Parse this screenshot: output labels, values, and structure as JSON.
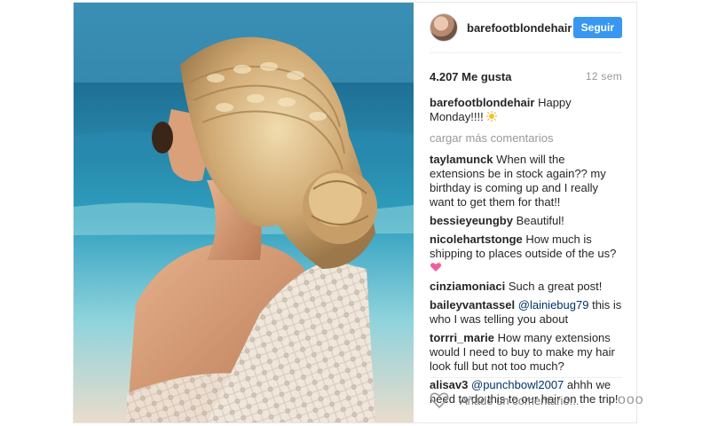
{
  "header": {
    "username": "barefootblondehair",
    "follow_label": "Seguir"
  },
  "stats": {
    "likes": "4.207 Me gusta",
    "time_ago": "12 sem"
  },
  "caption": {
    "user": "barefootblondehair",
    "text": "Happy Monday!!!!"
  },
  "load_more": "cargar más comentarios",
  "comments": [
    {
      "user": "taylamunck",
      "mention": "",
      "text": "When will the extensions be in stock again?? my birthday is coming up and I really want to get them for that!!"
    },
    {
      "user": "bessieyeungby",
      "mention": "",
      "text": "Beautiful!"
    },
    {
      "user": "nicolehartstonge",
      "mention": "",
      "text": "How much is shipping to places outside of the us?"
    },
    {
      "user": "cinziamoniaci",
      "mention": "",
      "text": "Such a great post!"
    },
    {
      "user": "baileyvantassel",
      "mention": "@lainiebug79",
      "text": "this is who I was telling you about"
    },
    {
      "user": "torrri_marie",
      "mention": "",
      "text": "How many extensions would I need to buy to make my hair look full but not too much?"
    },
    {
      "user": "alisav3",
      "mention": "@punchbowl2007",
      "text": "ahhh we need to do this to our hair on the trip!"
    }
  ],
  "footer": {
    "comment_placeholder": "Añade un comentario...",
    "more_label": "ooo"
  },
  "colors": {
    "accent": "#3897f0",
    "muted": "#999999",
    "text": "#262626",
    "mention": "#003569"
  }
}
